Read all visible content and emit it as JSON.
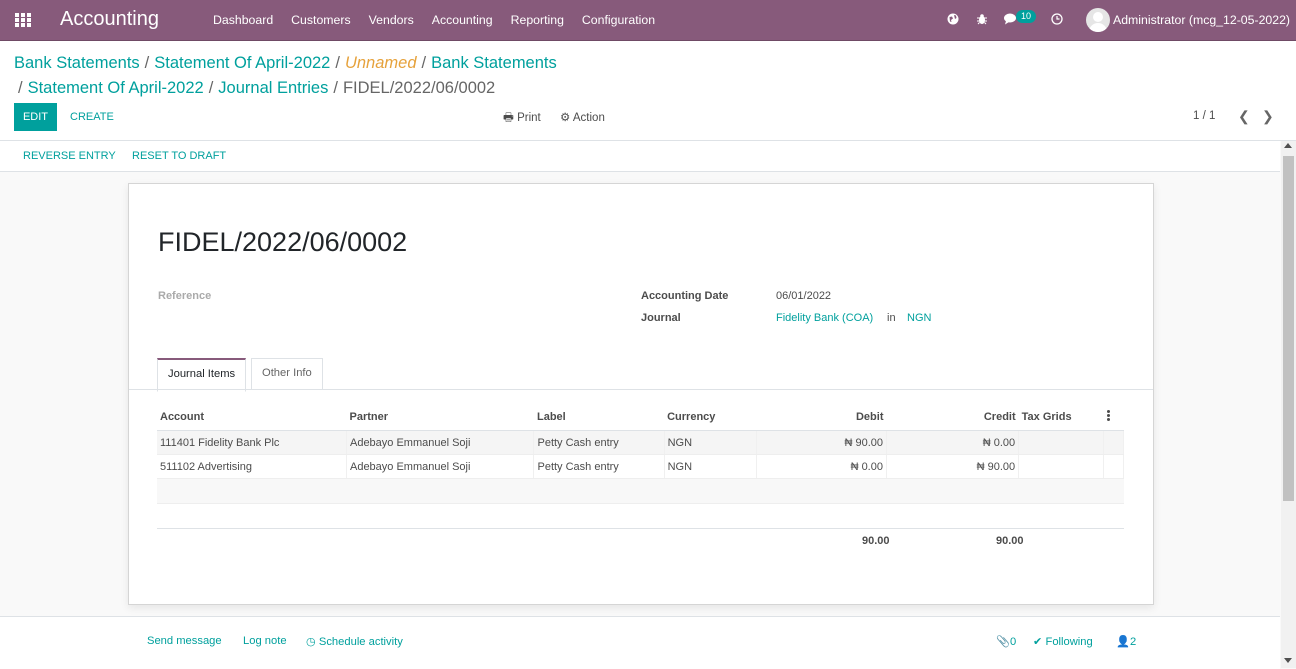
{
  "navbar": {
    "app_title": "Accounting",
    "menu": [
      "Dashboard",
      "Customers",
      "Vendors",
      "Accounting",
      "Reporting",
      "Configuration"
    ],
    "message_count": "10",
    "user": "Administrator (mcg_12-05-2022)"
  },
  "breadcrumb": {
    "items": [
      "Bank Statements",
      "Statement Of April-2022",
      "Unnamed",
      "Bank Statements",
      "Statement Of April-2022",
      "Journal Entries"
    ],
    "current": "FIDEL/2022/06/0002"
  },
  "toolbar": {
    "edit": "EDIT",
    "create": "CREATE",
    "print": "Print",
    "action": "Action",
    "pager": "1 / 1"
  },
  "statusbar": {
    "reverse": "REVERSE ENTRY",
    "reset": "RESET TO DRAFT"
  },
  "form": {
    "title": "FIDEL/2022/06/0002",
    "reference_label": "Reference",
    "date_label": "Accounting Date",
    "date_value": "06/01/2022",
    "journal_label": "Journal",
    "journal_value": "Fidelity Bank (COA)",
    "journal_in": "in",
    "journal_currency": "NGN"
  },
  "tabs": [
    "Journal Items",
    "Other Info"
  ],
  "lines": {
    "headers": [
      "Account",
      "Partner",
      "Label",
      "Currency",
      "Debit",
      "Credit",
      "Tax Grids"
    ],
    "rows": [
      [
        "111401 Fidelity Bank Plc",
        "Adebayo Emmanuel Soji",
        "Petty Cash entry",
        "NGN",
        "₦ 90.00",
        "₦ 0.00",
        ""
      ],
      [
        "511102 Advertising",
        "Adebayo Emmanuel Soji",
        "Petty Cash entry",
        "NGN",
        "₦ 0.00",
        "₦ 90.00",
        ""
      ]
    ],
    "total_debit": "90.00",
    "total_credit": "90.00"
  },
  "chatter": {
    "send": "Send message",
    "log": "Log note",
    "schedule": "Schedule activity",
    "attachments": "0",
    "following": "Following",
    "followers": "2"
  },
  "colors": {
    "navbar": "#875a7b",
    "accent": "#00a09d",
    "unnamed": "#e6a23c"
  }
}
